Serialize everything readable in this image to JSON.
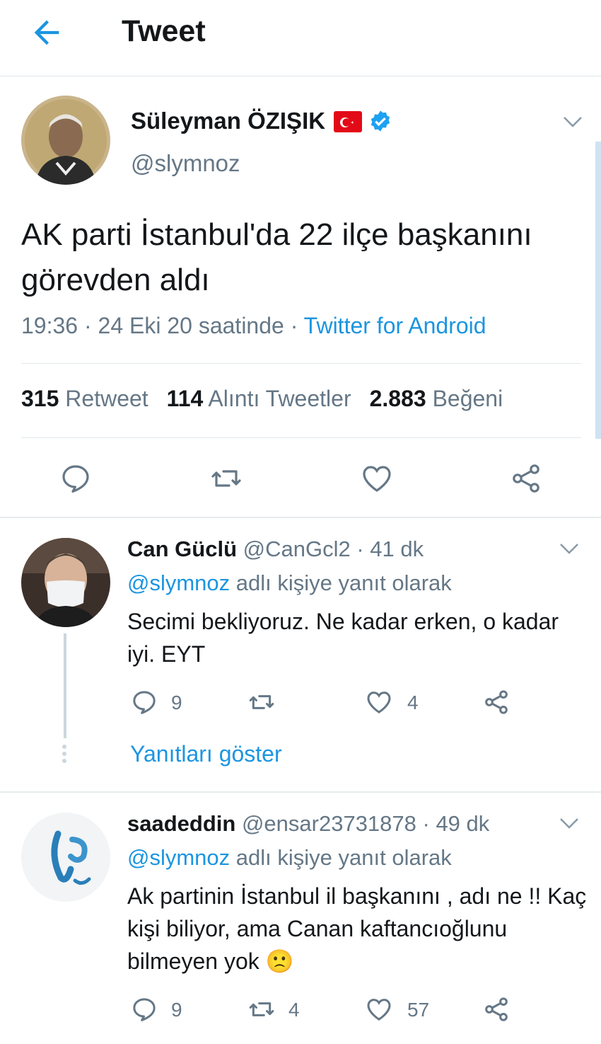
{
  "header": {
    "title": "Tweet"
  },
  "main_tweet": {
    "author_name": "Süleyman ÖZIŞIK",
    "handle": "@slymnoz",
    "text": "AK parti İstanbul'da 22 ilçe başkanını görevden aldı",
    "meta_time": "19:36 · 24 Eki 20 saatinde · ",
    "meta_source": "Twitter for Android",
    "stats": {
      "retweets": "315",
      "retweets_label": "Retweet",
      "quotes": "114",
      "quotes_label": "Alıntı Tweetler",
      "likes": "2.883",
      "likes_label": "Beğeni"
    }
  },
  "replies": [
    {
      "name": "Can Güclü",
      "handle_time": "@CanGcl2 · 41 dk",
      "mention": "@slymnoz",
      "reply_label": " adlı kişiye yanıt olarak",
      "text": "Secimi bekliyoruz. Ne kadar erken, o kadar iyi. EYT",
      "reply_count": "9",
      "retweet_count": "",
      "like_count": "4",
      "show_replies": "Yanıtları göster"
    },
    {
      "name": "saadeddin",
      "handle_time": "@ensar23731878 · 49 dk",
      "mention": "@slymnoz",
      "reply_label": " adlı kişiye yanıt olarak",
      "text": "Ak partinin İstanbul il başkanını , adı ne !! Kaç kişi biliyor, ama Canan kaftancıoğlunu bilmeyen yok 🙁",
      "reply_count": "9",
      "retweet_count": "4",
      "like_count": "57"
    }
  ],
  "colors": {
    "accent": "#1b95e0",
    "muted": "#657786",
    "text": "#14171a",
    "divider": "#e1e8ed"
  }
}
